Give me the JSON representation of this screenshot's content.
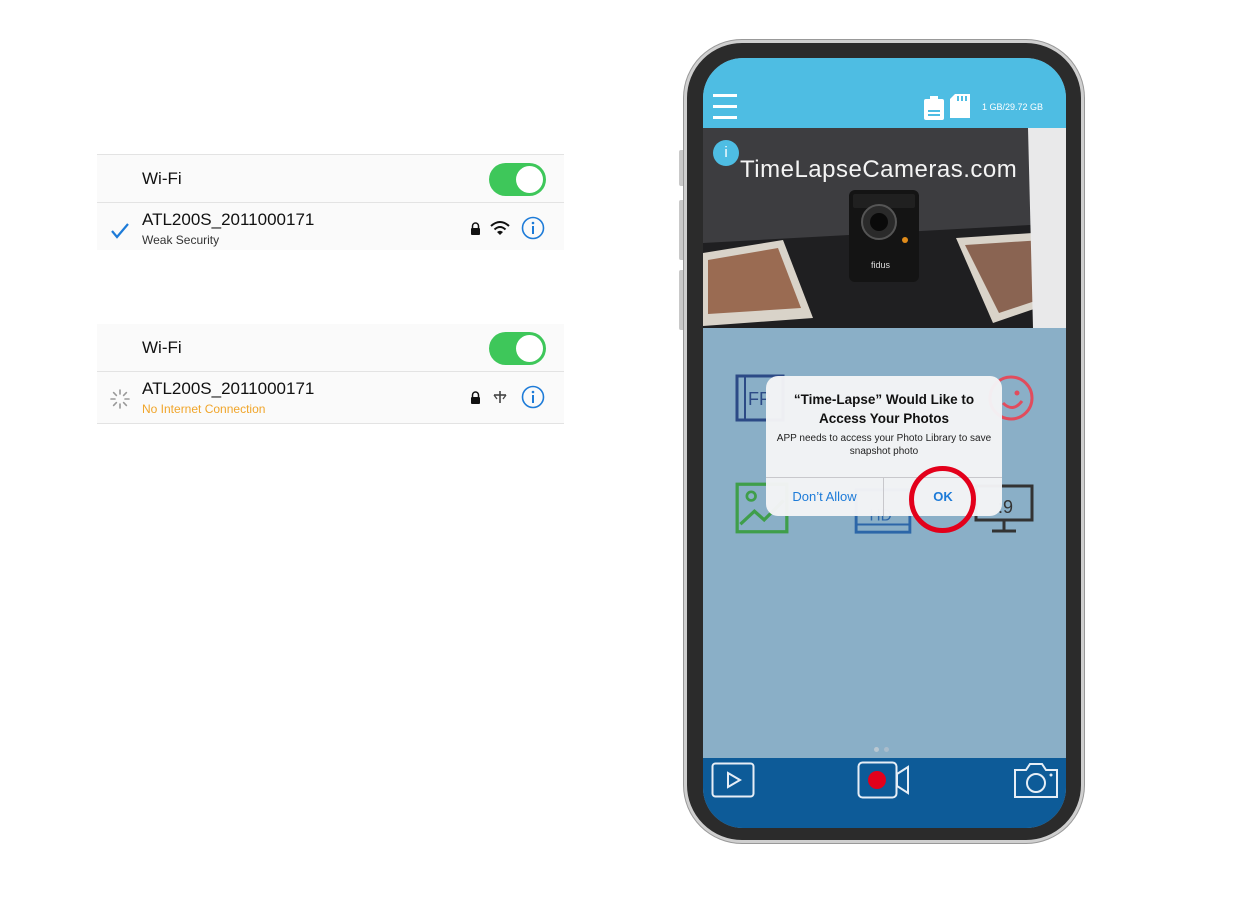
{
  "wifi_panels": [
    {
      "wifi_label": "Wi-Fi",
      "network_name": "ATL200S_2011000171",
      "network_subtitle": "Weak Security"
    },
    {
      "wifi_label": "Wi-Fi",
      "network_name": "ATL200S_2011000171",
      "network_subtitle": "No Internet Connection"
    }
  ],
  "app": {
    "storage": "1 GB/29.72 GB",
    "banner": "TimeLapseCameras.com",
    "info_icon_glyph": "i",
    "camera_brand": "fidus",
    "page_count": 2,
    "active_page": 1
  },
  "alert": {
    "title": "“Time-Lapse” Would Like to Access Your Photos",
    "message": "APP needs to access your Photo Library to save snapshot photo",
    "deny_label": "Don’t Allow",
    "ok_label": "OK"
  },
  "feature_icons": [
    "fps-film-icon",
    "smiley-icon",
    "photo-gallery-icon",
    "hd-film-icon",
    "aspect-ratio-monitor-icon"
  ],
  "bottom_bar_icons": [
    "play-icon",
    "record-icon",
    "camera-icon"
  ],
  "colors": {
    "toggle_on": "#3ec75a",
    "ios_blue": "#1d7bd8",
    "warning_orange": "#f0a52a",
    "app_header": "#4ebde3",
    "app_background": "#8aafc7",
    "bottom_bar": "#0d5b98",
    "highlight_red": "#e3001b"
  }
}
